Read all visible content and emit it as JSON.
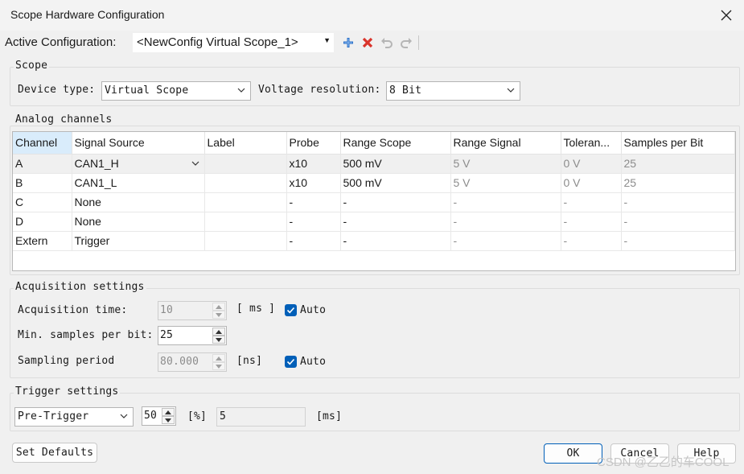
{
  "window": {
    "title": "Scope Hardware Configuration"
  },
  "toolbar": {
    "active_config_label": "Active Configuration:",
    "active_config_value": "<NewConfig Virtual Scope_1>",
    "icons": [
      "add-icon",
      "delete-icon",
      "undo-icon",
      "redo-icon"
    ]
  },
  "scope": {
    "group_title": "Scope",
    "device_type_label": "Device type:",
    "device_type_value": "Virtual Scope",
    "voltage_resolution_label": "Voltage resolution:",
    "voltage_resolution_value": "8 Bit"
  },
  "analog": {
    "group_title": "Analog channels",
    "columns": [
      "Channel",
      "Signal Source",
      "Label",
      "Probe",
      "Range Scope",
      "Range Signal",
      "Toleran...",
      "Samples per Bit"
    ],
    "rows": [
      [
        "A",
        "CAN1_H",
        "",
        "x10",
        "500 mV",
        "5 V",
        "0 V",
        "25"
      ],
      [
        "B",
        "CAN1_L",
        "",
        "x10",
        "500 mV",
        "5 V",
        "0 V",
        "25"
      ],
      [
        "C",
        "None",
        "",
        "-",
        "-",
        "-",
        "-",
        "-"
      ],
      [
        "D",
        "None",
        "",
        "-",
        "-",
        "-",
        "-",
        "-"
      ],
      [
        "Extern",
        "Trigger",
        "",
        "-",
        "-",
        "-",
        "-",
        "-"
      ]
    ]
  },
  "acquisition": {
    "group_title": "Acquisition settings",
    "time_label": "Acquisition time:",
    "time_value": "10",
    "time_unit": "[ ms ]",
    "time_auto_label": "Auto",
    "min_samples_label": "Min. samples per bit:",
    "min_samples_value": "25",
    "sampling_label": "Sampling period",
    "sampling_value": "80.000",
    "sampling_unit": "[ns]",
    "sampling_auto_label": "Auto"
  },
  "trigger": {
    "group_title": "Trigger settings",
    "mode_value": "Pre-Trigger",
    "percent_value": "50",
    "percent_unit": "[%]",
    "time_value": "5",
    "time_unit": "[ms]"
  },
  "buttons": {
    "set_defaults": "Set Defaults",
    "ok": "OK",
    "cancel": "Cancel",
    "help": "Help"
  },
  "watermark": "CSDN @乙乙的车COOL",
  "colors": {
    "accent": "#005fb8",
    "selected_header": "#d9ecfb",
    "add_icon": "#2a6fc9",
    "delete_icon": "#d9342b"
  }
}
